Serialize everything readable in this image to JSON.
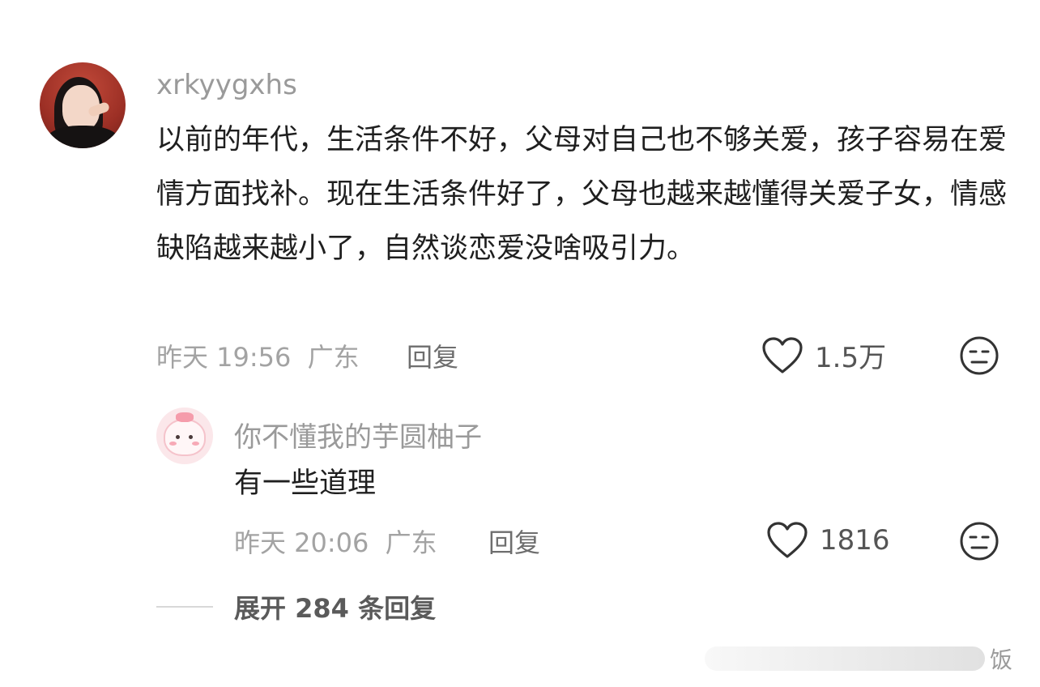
{
  "comment": {
    "username": "xrkyygxhs",
    "text": "以前的年代，生活条件不好，父母对自己也不够关爱，孩子容易在爱情方面找补。现在生活条件好了，父母也越来越懂得关爱子女，情感缺陷越来越小了，自然谈恋爱没啥吸引力。",
    "time": "昨天 19:56",
    "location": "广东",
    "reply_label": "回复",
    "likes": "1.5万"
  },
  "reply": {
    "username": "你不懂我的芋圆柚子",
    "text": "有一些道理",
    "time": "昨天 20:06",
    "location": "广东",
    "reply_label": "回复",
    "likes": "1816"
  },
  "expand": {
    "label": "展开 284 条回复"
  },
  "watermark": {
    "text": "饭"
  },
  "icons": {
    "like": "heart-outline-icon",
    "dislike": "neutral-face-icon"
  }
}
